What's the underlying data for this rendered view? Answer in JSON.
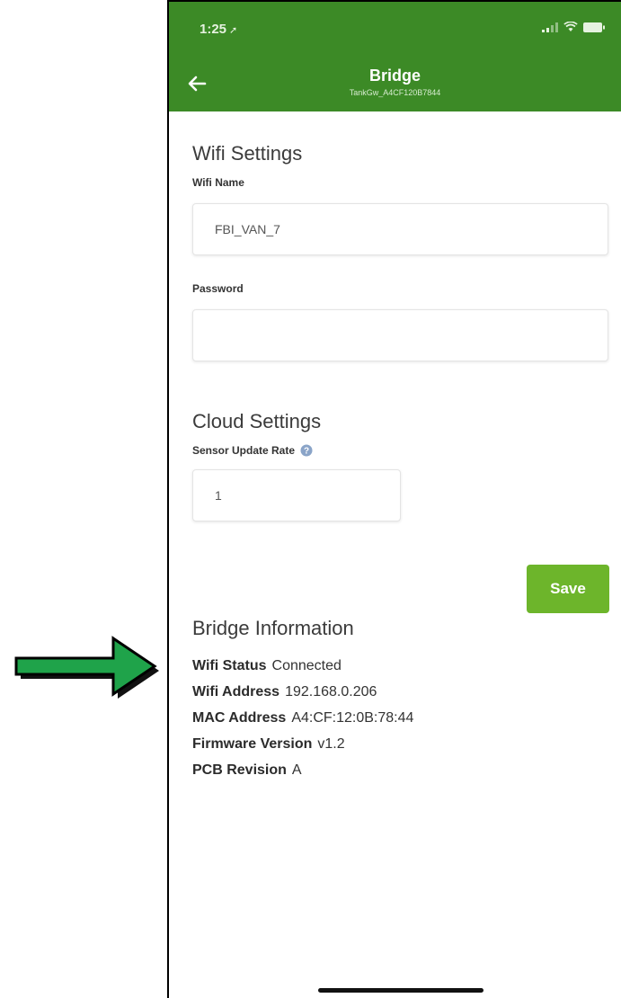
{
  "status_bar": {
    "time": "1:25",
    "location_glyph": "➚"
  },
  "header": {
    "title": "Bridge",
    "subtitle": "TankGw_A4CF120B7844",
    "back_icon": "arrow-left-icon",
    "color": "#3c8a26"
  },
  "wifi_settings": {
    "title": "Wifi Settings",
    "name_label": "Wifi Name",
    "name_value": "FBI_VAN_7",
    "password_label": "Password",
    "password_value": ""
  },
  "cloud_settings": {
    "title": "Cloud Settings",
    "rate_label": "Sensor Update Rate",
    "rate_value": "1",
    "help_icon": "question-circle-icon"
  },
  "save_label": "Save",
  "save_color": "#6db52b",
  "bridge_info": {
    "title": "Bridge Information",
    "rows": [
      {
        "key": "Wifi Status",
        "value": "Connected"
      },
      {
        "key": "Wifi Address",
        "value": "192.168.0.206"
      },
      {
        "key": "MAC Address",
        "value": "A4:CF:12:0B:78:44"
      },
      {
        "key": "Firmware Version",
        "value": "v1.2"
      },
      {
        "key": "PCB Revision",
        "value": "A"
      }
    ]
  },
  "annotation": {
    "arrow_color": "#1fa34a"
  }
}
